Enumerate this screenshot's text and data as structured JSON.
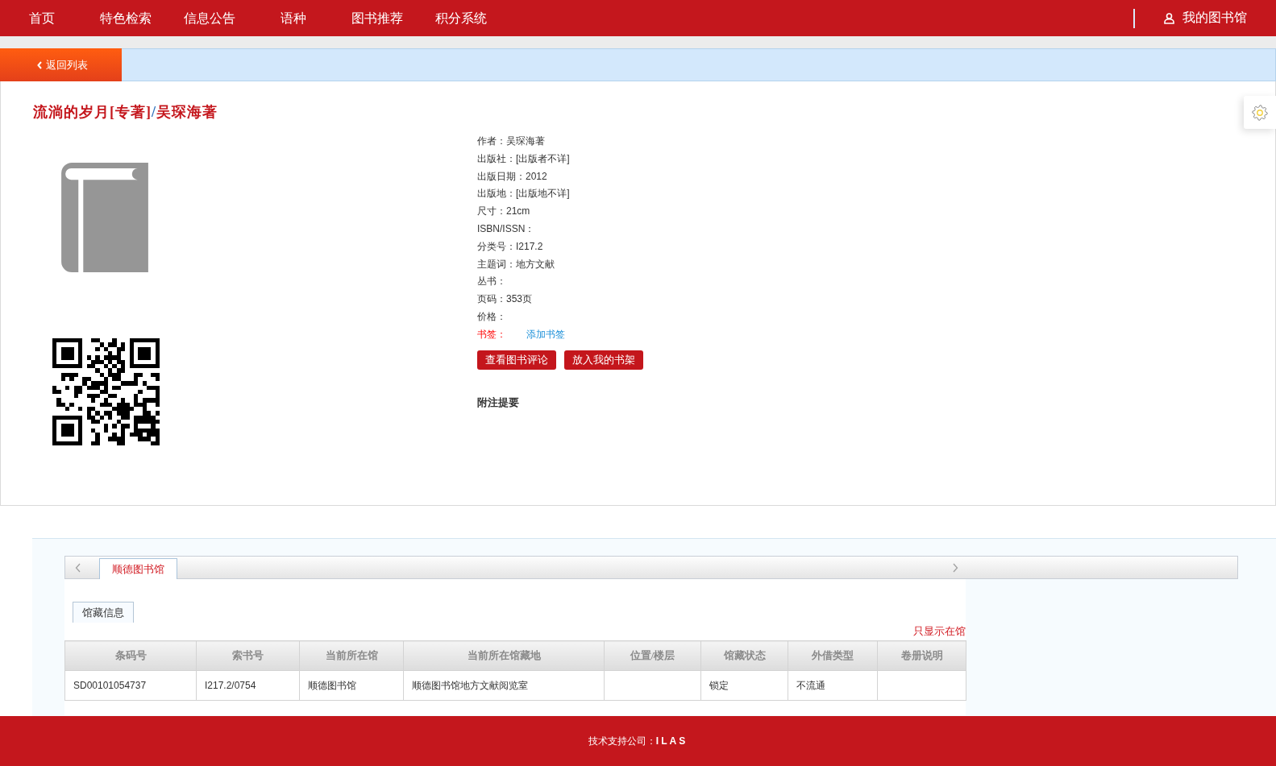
{
  "nav": {
    "items": [
      "首页",
      "特色检索",
      "信息公告",
      "语种",
      "图书推荐",
      "积分系统"
    ],
    "account_link": "我的图书馆"
  },
  "back_button": "返回列表",
  "book": {
    "title": "流淌的岁月[专著]",
    "title_separator": "/",
    "statement_of_responsibility": "吴琛海著",
    "fields": [
      {
        "label": "作者：",
        "value": "吴琛海著"
      },
      {
        "label": "出版社：",
        "value": "[出版者不详]"
      },
      {
        "label": "出版日期：",
        "value": "2012"
      },
      {
        "label": "出版地：",
        "value": "[出版地不详]"
      },
      {
        "label": "尺寸：",
        "value": "21cm"
      },
      {
        "label": "ISBN/ISSN："
      },
      {
        "label": "分类号：",
        "value": "I217.2"
      },
      {
        "label": "主题词：",
        "value": "地方文献"
      },
      {
        "label": "丛书："
      },
      {
        "label": "页码：",
        "value": "353页"
      },
      {
        "label": "价格："
      }
    ],
    "bookmark": {
      "label": "书签：",
      "link": "添加书签"
    },
    "buttons": [
      "查看图书评论",
      "放入我的书架"
    ],
    "notes_heading": "附注提要"
  },
  "holdings": {
    "library_tabs": [
      {
        "label": "顺德图书馆",
        "selected": true
      }
    ],
    "info_tabs": [
      {
        "label": "馆藏信息",
        "selected": true
      }
    ],
    "filter_link": "只显示在馆",
    "table": {
      "columns": [
        "条码号",
        "索书号",
        "当前所在馆",
        "当前所在馆藏地",
        "位置/楼层",
        "馆藏状态",
        "外借类型",
        "卷册说明"
      ],
      "rows": [
        [
          "SD00101054737",
          "I217.2/0754",
          "顺德图书馆",
          "顺德图书馆地方文献阅览室",
          null,
          "锁定",
          "不流通",
          null
        ]
      ]
    }
  },
  "footer": {
    "text": "技术支持公司：**ILAS**"
  }
}
